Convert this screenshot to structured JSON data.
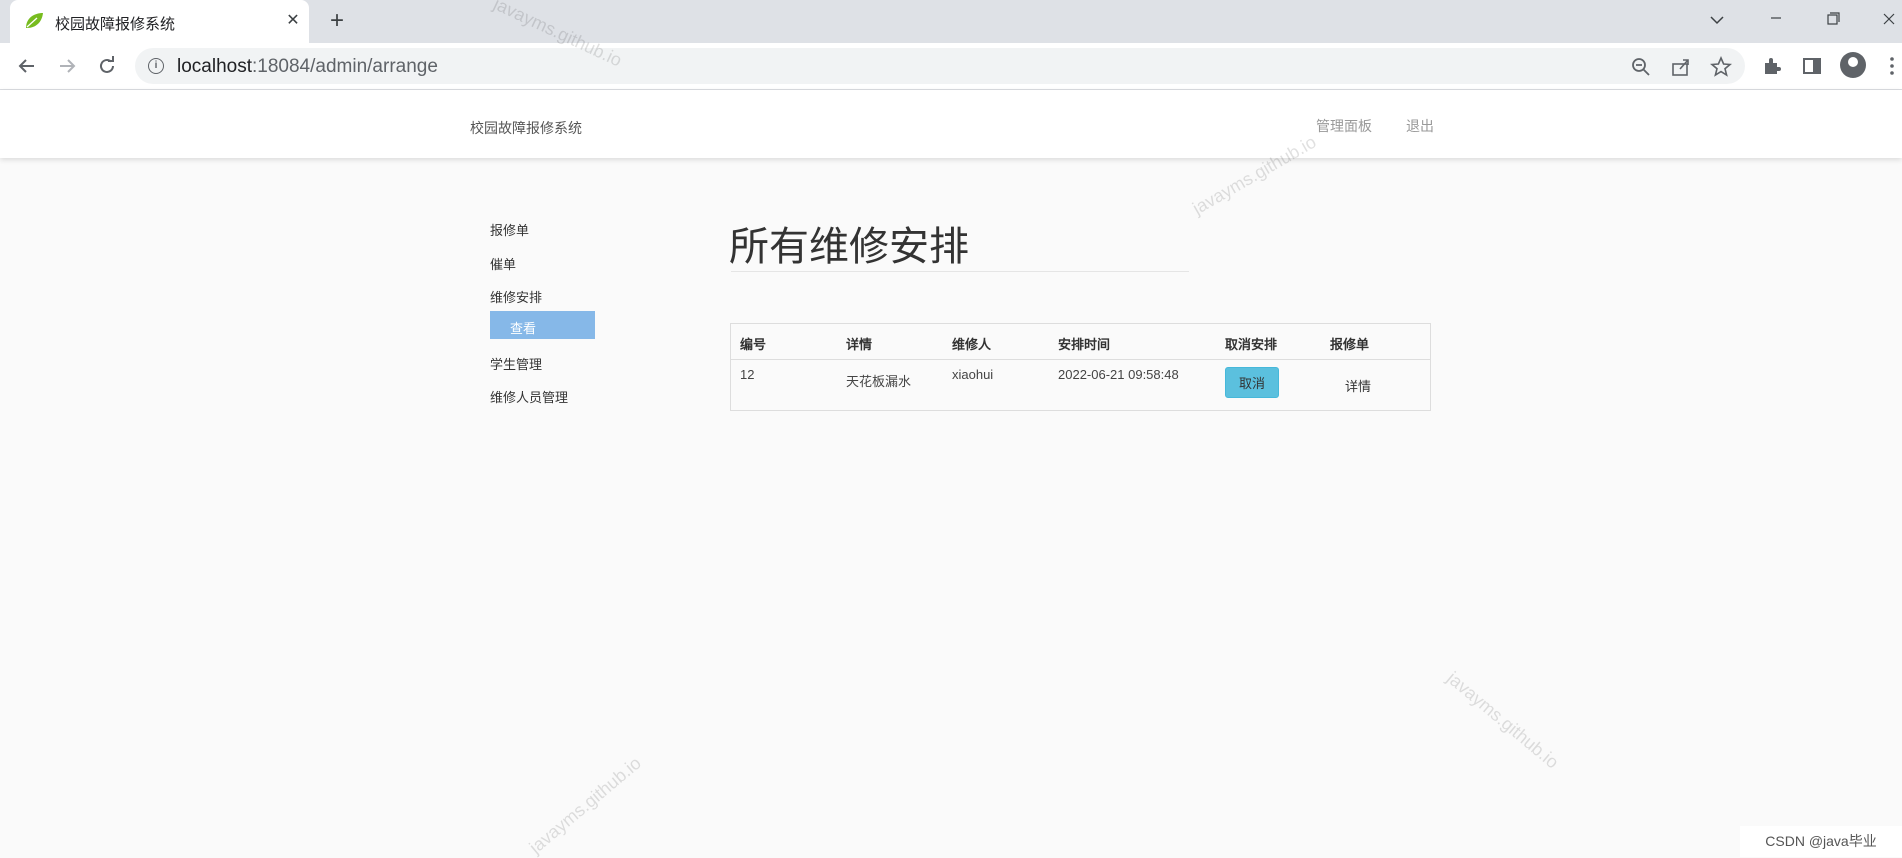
{
  "browser": {
    "tab_title": "校园故障报修系统",
    "tab_close": "✕",
    "new_tab": "+",
    "url_host": "localhost",
    "url_rest": ":18084/admin/arrange"
  },
  "header": {
    "brand": "校园故障报修系统",
    "dashboard_link": "管理面板",
    "logout_link": "退出"
  },
  "sidebar": {
    "items": [
      {
        "label": "报修单"
      },
      {
        "label": "催单"
      },
      {
        "label": "维修安排"
      },
      {
        "label": "学生管理"
      },
      {
        "label": "维修人员管理"
      }
    ],
    "active_sub": "查看"
  },
  "main": {
    "title": "所有维修安排",
    "table": {
      "headers": [
        "编号",
        "详情",
        "维修人",
        "安排时间",
        "取消安排",
        "报修单"
      ],
      "rows": [
        {
          "id": "12",
          "detail": "天花板漏水",
          "repairer": "xiaohui",
          "time": "2022-06-21 09:58:48",
          "cancel": "取消",
          "order": "详情"
        }
      ]
    }
  },
  "watermarks": {
    "text": "javayms.github.io",
    "csdn": "CSDN @java毕业"
  },
  "icons": [
    "leaf-favicon-icon",
    "close-icon",
    "plus-icon",
    "chevron-down-icon",
    "minimize-icon",
    "restore-icon",
    "window-close-icon",
    "back-arrow-icon",
    "forward-arrow-icon",
    "reload-icon",
    "info-icon",
    "zoom-out-icon",
    "share-icon",
    "star-icon",
    "extensions-icon",
    "sidepanel-icon",
    "profile-icon",
    "kebab-menu-icon"
  ]
}
